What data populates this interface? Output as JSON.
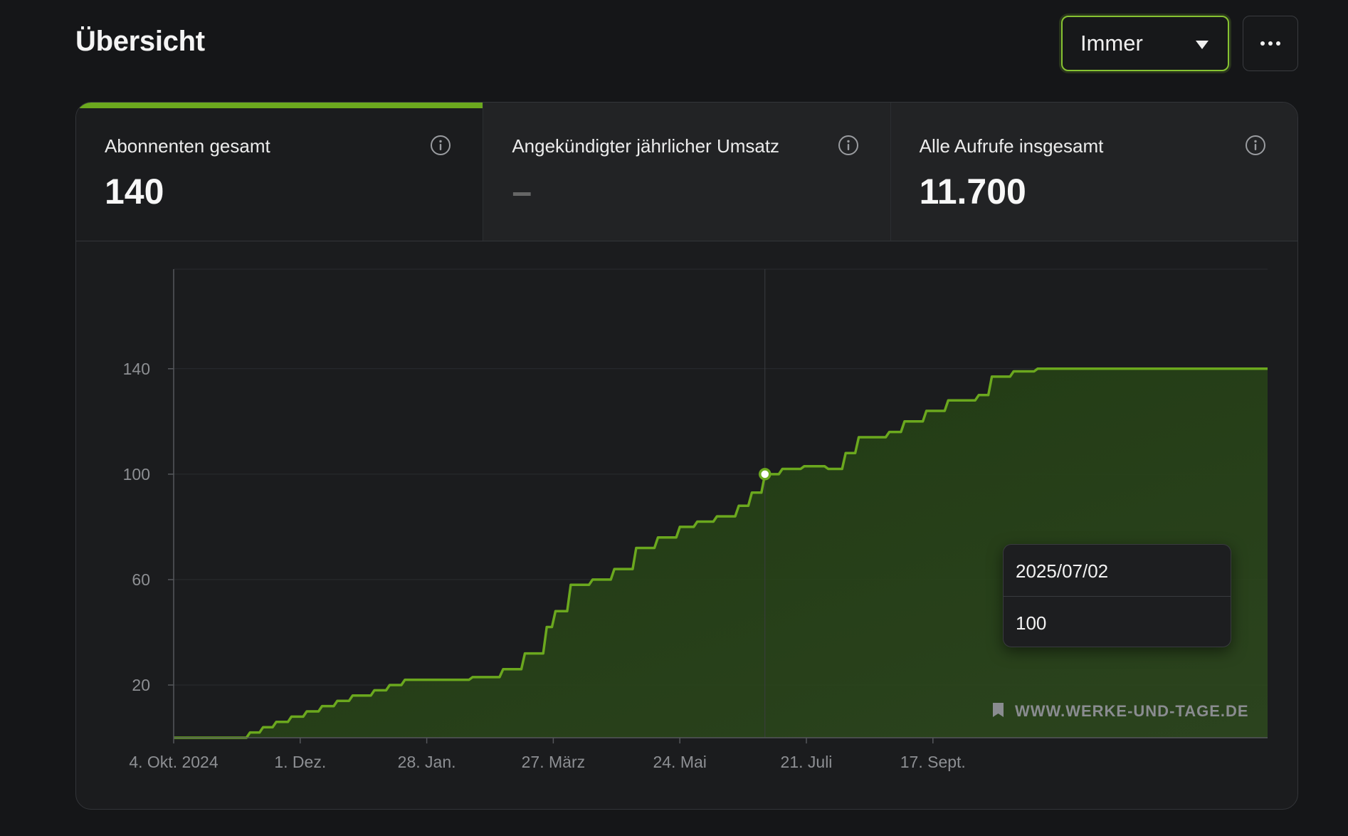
{
  "header": {
    "title": "Übersicht",
    "range_select": {
      "value": "Immer"
    },
    "more_button_icon": "more-horizontal-icon"
  },
  "stats": [
    {
      "label": "Abonnenten gesamt",
      "value": "140",
      "active": true
    },
    {
      "label": "Angekündigter jährlicher Umsatz",
      "value": "–",
      "active": false
    },
    {
      "label": "Alle Aufrufe insgesamt",
      "value": "11.700",
      "active": false
    }
  ],
  "colors": {
    "accent": "#86c232",
    "line": "#6ba81e",
    "background": "#151618",
    "card": "#1b1c1e"
  },
  "chart_data": {
    "type": "area",
    "ylim": [
      0,
      148
    ],
    "y_ticks": [
      20,
      60,
      100,
      140
    ],
    "x_ticks": [
      "4. Okt. 2024",
      "1. Dez.",
      "28. Jan.",
      "27. März",
      "24. Mai",
      "21. Juli",
      "17. Sept."
    ],
    "x": [
      "2024-10-04",
      "2024-11-04",
      "2024-11-08",
      "2024-11-14",
      "2024-11-20",
      "2024-11-27",
      "2024-12-04",
      "2024-12-11",
      "2024-12-18",
      "2024-12-25",
      "2025-01-04",
      "2025-01-11",
      "2025-01-18",
      "2025-02-04",
      "2025-02-18",
      "2025-03-04",
      "2025-03-14",
      "2025-03-24",
      "2025-03-28",
      "2025-04-04",
      "2025-04-07",
      "2025-04-14",
      "2025-04-24",
      "2025-05-04",
      "2025-05-14",
      "2025-05-24",
      "2025-06-01",
      "2025-06-10",
      "2025-06-20",
      "2025-06-26",
      "2025-07-02",
      "2025-07-10",
      "2025-07-20",
      "2025-07-31",
      "2025-08-08",
      "2025-08-14",
      "2025-08-28",
      "2025-09-04",
      "2025-09-14",
      "2025-09-24",
      "2025-10-08",
      "2025-10-14",
      "2025-10-24",
      "2025-11-04"
    ],
    "y": [
      0,
      0,
      2,
      4,
      6,
      8,
      10,
      12,
      14,
      16,
      18,
      20,
      22,
      22,
      23,
      26,
      32,
      42,
      48,
      58,
      58,
      60,
      64,
      72,
      76,
      80,
      82,
      84,
      88,
      93,
      100,
      102,
      103,
      102,
      108,
      114,
      116,
      120,
      124,
      128,
      130,
      137,
      139,
      140
    ],
    "tooltip": {
      "date": "2025/07/02",
      "value": "100"
    },
    "watermark": "WWW.WERKE-UND-TAGE.DE",
    "grid": true
  }
}
